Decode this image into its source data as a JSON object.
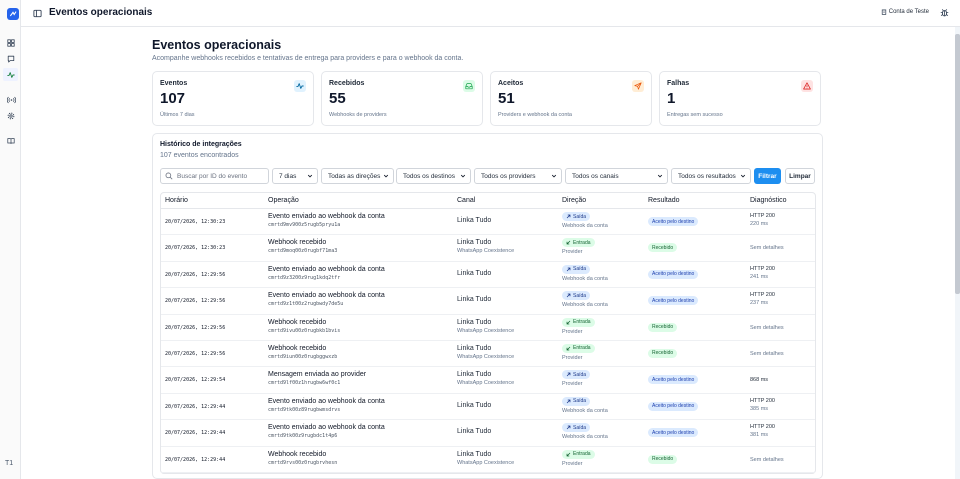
{
  "colors": {
    "accent": "#1d8ef0",
    "brand": "#2563eb",
    "success": "#16a34a",
    "danger": "#dc2626",
    "warning": "#f97316"
  },
  "sidebar": {
    "logo_icon": "logo-icon",
    "items": [
      {
        "icon": "grid-icon",
        "active": false
      },
      {
        "icon": "message-icon",
        "active": false
      },
      {
        "icon": "activity-icon",
        "active": true
      },
      {
        "icon": "broadcast-icon",
        "active": false
      },
      {
        "icon": "gear-icon",
        "active": false
      },
      {
        "icon": "book-icon",
        "active": false
      }
    ],
    "user_initials": "T1"
  },
  "topbar": {
    "title": "Eventos operacionais",
    "account_label": "Conta de Teste"
  },
  "page": {
    "title": "Eventos operacionais",
    "subtitle": "Acompanhe webhooks recebidos e tentativas de entrega para providers e para o webhook da conta."
  },
  "stats": [
    {
      "label": "Eventos",
      "value": "107",
      "note": "Últimos 7 dias",
      "icon": "activity-icon"
    },
    {
      "label": "Recebidos",
      "value": "55",
      "note": "Webhooks de providers",
      "icon": "inbox-icon"
    },
    {
      "label": "Aceitos",
      "value": "51",
      "note": "Providers e webhook da conta",
      "icon": "send-icon"
    },
    {
      "label": "Falhas",
      "value": "1",
      "note": "Entregas sem sucesso",
      "icon": "alert-triangle-icon"
    }
  ],
  "history": {
    "title": "Histórico de integrações",
    "count_text": "107 eventos encontrados",
    "search_placeholder": "Buscar por ID do evento",
    "filters": {
      "period": "7 dias",
      "direction": "Todas as direções",
      "destination": "Todos os destinos",
      "provider": "Todos os providers",
      "channel": "Todos os canais",
      "result": "Todos os resultados"
    },
    "filter_button": "Filtrar",
    "clear_button": "Limpar",
    "columns": [
      "Horário",
      "Operação",
      "Canal",
      "Direção",
      "Resultado",
      "Diagnóstico"
    ],
    "rows": [
      {
        "time": "20/07/2026, 12:30:23",
        "op": "Evento enviado ao webhook da conta",
        "id": "cmrtd9mv900z5rugb5pryu1a",
        "channel": "Linka Tudo",
        "channel_sub": "",
        "dir": "Saída",
        "dir_sub": "Webhook da conta",
        "result": "Aceito pelo destino",
        "diag": "HTTP 200",
        "diag_sub": "220 ms"
      },
      {
        "time": "20/07/2026, 12:30:23",
        "op": "Webhook recebido",
        "id": "cmrtd9moq00z0rugbf71ma3",
        "channel": "Linka Tudo",
        "channel_sub": "WhatsApp Coexistence",
        "dir": "Entrada",
        "dir_sub": "Provider",
        "result": "Recebido",
        "diag": "Sem detalhes",
        "diag_sub": ""
      },
      {
        "time": "20/07/2026, 12:29:56",
        "op": "Evento enviado ao webhook da conta",
        "id": "cmrtd9z3200z9rug1kdq2tfr",
        "channel": "Linka Tudo",
        "channel_sub": "",
        "dir": "Saída",
        "dir_sub": "Webhook da conta",
        "result": "Aceito pelo destino",
        "diag": "HTTP 200",
        "diag_sub": "241 ms"
      },
      {
        "time": "20/07/2026, 12:29:56",
        "op": "Evento enviado ao webhook da conta",
        "id": "cmrtd9z1t00z2rugbwdy7de5u",
        "channel": "Linka Tudo",
        "channel_sub": "",
        "dir": "Saída",
        "dir_sub": "Webhook da conta",
        "result": "Aceito pelo destino",
        "diag": "HTTP 200",
        "diag_sub": "237 ms"
      },
      {
        "time": "20/07/2026, 12:29:56",
        "op": "Webhook recebido",
        "id": "cmrtd9ivu00z0rugbkb1bvis",
        "channel": "Linka Tudo",
        "channel_sub": "WhatsApp Coexistence",
        "dir": "Entrada",
        "dir_sub": "Provider",
        "result": "Recebido",
        "diag": "Sem detalhes",
        "diag_sub": ""
      },
      {
        "time": "20/07/2026, 12:29:56",
        "op": "Webhook recebido",
        "id": "cmrtd9iun00z0rugbggwxzb",
        "channel": "Linka Tudo",
        "channel_sub": "WhatsApp Coexistence",
        "dir": "Entrada",
        "dir_sub": "Provider",
        "result": "Recebido",
        "diag": "Sem detalhes",
        "diag_sub": ""
      },
      {
        "time": "20/07/2026, 12:29:54",
        "op": "Mensagem enviada ao provider",
        "id": "cmrtd9lf00z1hrugbw6wf0c1",
        "channel": "Linka Tudo",
        "channel_sub": "WhatsApp Coexistence",
        "dir": "Saída",
        "dir_sub": "Provider",
        "result": "Aceito pelo destino",
        "diag": "868 ms",
        "diag_sub": ""
      },
      {
        "time": "20/07/2026, 12:29:44",
        "op": "Evento enviado ao webhook da conta",
        "id": "cmrtd9tk00z89rugbwmsdrvs",
        "channel": "Linka Tudo",
        "channel_sub": "",
        "dir": "Saída",
        "dir_sub": "Webhook da conta",
        "result": "Aceito pelo destino",
        "diag": "HTTP 200",
        "diag_sub": "385 ms"
      },
      {
        "time": "20/07/2026, 12:29:44",
        "op": "Evento enviado ao webhook da conta",
        "id": "cmrtd9tk00z9rugbdc1t4p6",
        "channel": "Linka Tudo",
        "channel_sub": "",
        "dir": "Saída",
        "dir_sub": "Webhook da conta",
        "result": "Aceito pelo destino",
        "diag": "HTTP 200",
        "diag_sub": "381 ms"
      },
      {
        "time": "20/07/2026, 12:29:44",
        "op": "Webhook recebido",
        "id": "cmrtd9rvs00z0rugbrvhesn",
        "channel": "Linka Tudo",
        "channel_sub": "WhatsApp Coexistence",
        "dir": "Entrada",
        "dir_sub": "Provider",
        "result": "Recebido",
        "diag": "Sem detalhes",
        "diag_sub": ""
      }
    ]
  }
}
